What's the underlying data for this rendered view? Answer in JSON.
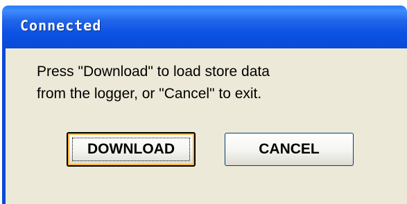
{
  "window": {
    "title": "Connected"
  },
  "dialog": {
    "message_line1": "Press \"Download\" to load store data",
    "message_line2": "from the logger, or \"Cancel\" to exit."
  },
  "buttons": {
    "download_label": "DOWNLOAD",
    "cancel_label": "CANCEL"
  },
  "colors": {
    "titlebar": "#0a4ad6",
    "client_background": "#ece9d8",
    "focus_ring": "#f8b33a"
  }
}
